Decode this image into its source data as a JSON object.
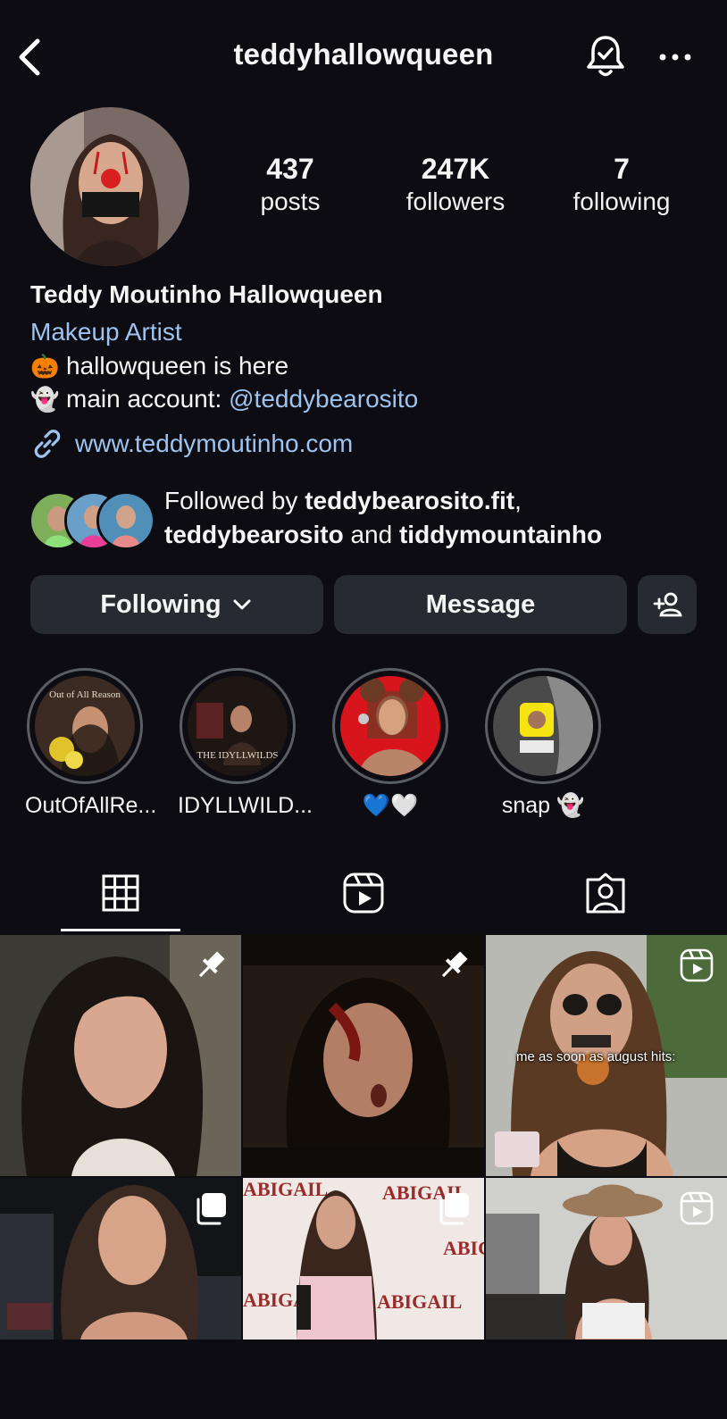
{
  "header": {
    "username": "teddyhallowqueen"
  },
  "stats": [
    {
      "value": "437",
      "label": "posts"
    },
    {
      "value": "247K",
      "label": "followers"
    },
    {
      "value": "7",
      "label": "following"
    }
  ],
  "bio": {
    "name": "Teddy Moutinho Hallowqueen",
    "category": "Makeup Artist",
    "line1_emoji": "🎃",
    "line1_text": "hallowqueen is here",
    "line2_emoji": "👻",
    "line2_text": "main account: ",
    "line2_mention": "@teddybearosito",
    "link": "www.teddymoutinho.com"
  },
  "followed_by": {
    "prefix": "Followed by ",
    "user1": "teddybearosito.fit",
    "sep1": ",",
    "user2": "teddybearosito",
    "and": " and ",
    "user3": "tiddymountainho"
  },
  "actions": {
    "following": "Following",
    "message": "Message"
  },
  "highlights": [
    {
      "label": "OutOfAllRe...",
      "cover_text": "Out of All Reason"
    },
    {
      "label": "IDYLLWILD...",
      "cover_text": "THE IDYLLWILDS"
    },
    {
      "label": "💙🤍"
    },
    {
      "label": "snap 👻"
    }
  ],
  "posts": [
    {
      "badge": "pin"
    },
    {
      "badge": "pin"
    },
    {
      "badge": "reel",
      "caption": "me as soon as august hits:"
    },
    {
      "badge": "carousel"
    },
    {
      "badge": "carousel",
      "overlay_text": "ABIGAIL"
    },
    {
      "badge": "reel"
    }
  ],
  "colors": {
    "background": "#0c0c12",
    "link": "#9ec3ee",
    "button": "#272a30"
  }
}
